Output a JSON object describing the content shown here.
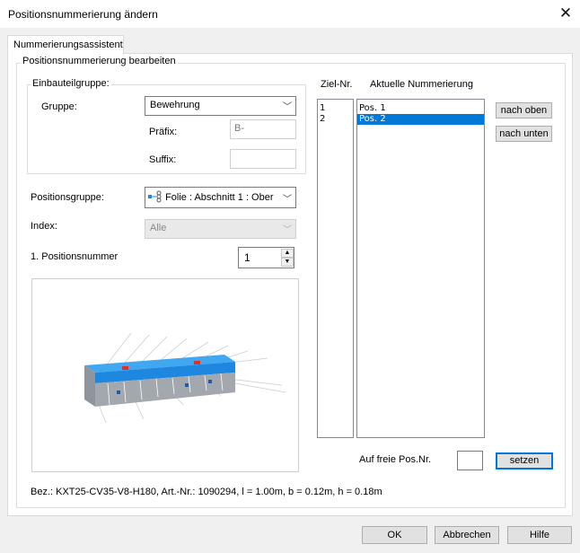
{
  "window": {
    "title": "Positionsnummerierung ändern",
    "close_glyph": "✕"
  },
  "tab": {
    "label": "Nummerierungsassistent"
  },
  "edit_group": {
    "label": "Positionsnummerierung bearbeiten"
  },
  "component_group": {
    "label": "Einbauteilgruppe:",
    "group_label": "Gruppe:",
    "group_value": "Bewehrung",
    "prefix_label": "Präfix:",
    "prefix_value": "B-",
    "suffix_label": "Suffix:",
    "suffix_value": ""
  },
  "position_group": {
    "label": "Positionsgruppe:",
    "value": "Folie : Abschnitt 1 : Ober"
  },
  "index": {
    "label": "Index:",
    "value": "Alle"
  },
  "first_position": {
    "label": "1. Positionsnummer",
    "value": "1"
  },
  "list": {
    "target_header": "Ziel-Nr.",
    "current_header": "Aktuelle Nummerierung",
    "target_numbers": [
      "1",
      "2"
    ],
    "current_items": [
      "Pos. 1",
      "Pos. 2"
    ],
    "selected_index": 1
  },
  "buttons": {
    "up": "nach oben",
    "down": "nach unten",
    "free_pos_label": "Auf freie Pos.Nr.",
    "free_pos_value": "",
    "set": "setzen",
    "ok": "OK",
    "cancel": "Abbrechen",
    "help": "Hilfe"
  },
  "description": "Bez.: KXT25-CV35-V8-H180, Art.-Nr.: 1090294, l = 1.00m, b = 0.12m, h = 0.18m",
  "colors": {
    "accent": "#0078d7",
    "beam_blue": "#1e88e0",
    "beam_grey": "#9aa0a8",
    "marker_red": "#d8322a"
  },
  "icons": {
    "close": "close-icon",
    "dropdown": "chevron-down-icon",
    "layer": "layer-group-icon",
    "spin_up": "arrow-up-icon",
    "spin_down": "arrow-down-icon"
  }
}
